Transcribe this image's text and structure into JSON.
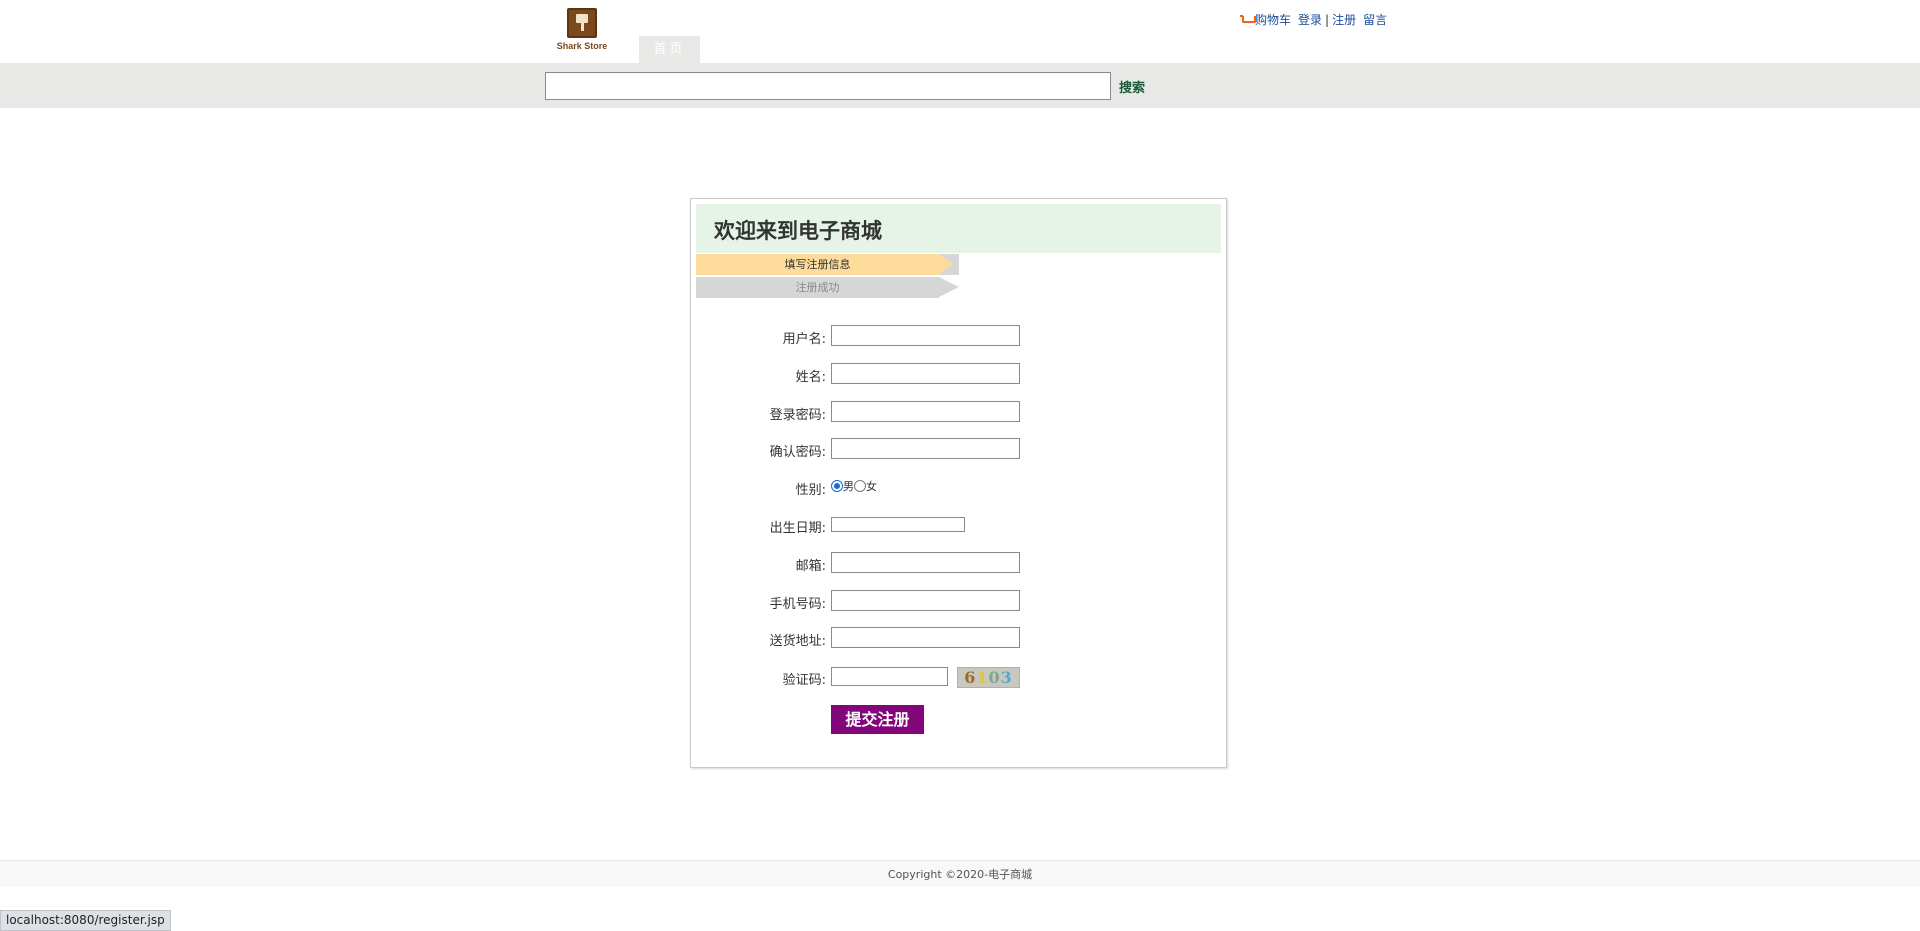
{
  "header": {
    "logo_text": "Shark Store",
    "nav_tab": "首页",
    "links": {
      "cart": "购物车",
      "login": "登录",
      "separator": "|",
      "register": "注册",
      "message": "留言"
    }
  },
  "search": {
    "value": "",
    "button": "搜索"
  },
  "panel": {
    "title": "欢迎来到电子商城",
    "steps": [
      "填写注册信息",
      "注册成功"
    ],
    "fields": {
      "username": "用户名:",
      "name": "姓名:",
      "password": "登录密码:",
      "confirm_password": "确认密码:",
      "gender": "性别:",
      "birthdate": "出生日期:",
      "email": "邮箱:",
      "phone": "手机号码:",
      "address": "送货地址:",
      "captcha": "验证码:"
    },
    "gender_options": [
      "男",
      "女"
    ],
    "gender_selected": "男",
    "captcha_chars": [
      "6",
      "1",
      "0",
      "3"
    ],
    "submit": "提交注册"
  },
  "footer": {
    "copyright": "Copyright ©2020-电子商城"
  },
  "status_bar": {
    "url": "localhost:8080/register.jsp"
  },
  "colors": {
    "accent_purple": "#82057a",
    "title_bg": "#e6f4e8",
    "active_step": "#fddb9a",
    "inactive_step": "#d6d6d6",
    "link_blue": "#1a4d9c",
    "search_bar_bg": "#e8e8e6"
  }
}
